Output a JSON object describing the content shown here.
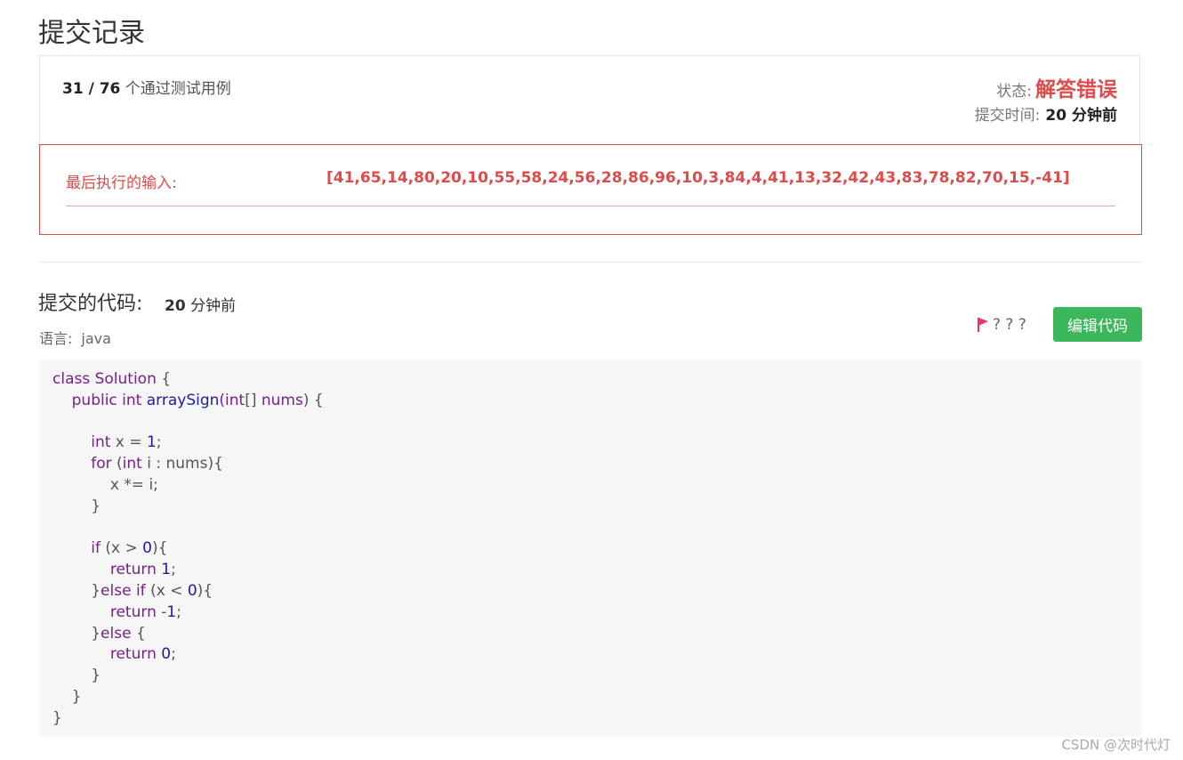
{
  "page_title": "提交记录",
  "result": {
    "passed": "31 / 76",
    "passed_suffix": "个通过测试用例",
    "status_label": "状态:",
    "status_value": "解答错误",
    "time_label": "提交时间:",
    "time_value": "20 分钟前"
  },
  "error": {
    "last_input_label": "最后执行的输入:",
    "last_input_value": "[41,65,14,80,20,10,55,58,24,56,28,86,96,10,3,84,4,41,13,32,42,43,83,78,82,70,15,-41]"
  },
  "code_section": {
    "title": "提交的代码:",
    "time_value": "20",
    "time_suffix": "分钟前",
    "lang_label": "语言:",
    "lang_value": "java",
    "flag_text": "? ? ?",
    "edit_button": "编辑代码"
  },
  "code_lines": [
    [
      [
        "kw",
        "class Solution"
      ],
      [
        "p",
        " {"
      ]
    ],
    [
      [
        "p",
        "    "
      ],
      [
        "kw",
        "public int "
      ],
      [
        "fn",
        "arraySign"
      ],
      [
        "kw",
        "(int"
      ],
      [
        "p",
        "[] "
      ],
      [
        "kw",
        "nums"
      ],
      [
        "p",
        ") {"
      ]
    ],
    [
      [
        "p",
        ""
      ]
    ],
    [
      [
        "p",
        "        "
      ],
      [
        "kw",
        "int"
      ],
      [
        "p",
        " x = "
      ],
      [
        "num",
        "1"
      ],
      [
        "p",
        ";"
      ]
    ],
    [
      [
        "p",
        "        "
      ],
      [
        "kw",
        "for"
      ],
      [
        "p",
        " ("
      ],
      [
        "kw",
        "int"
      ],
      [
        "p",
        " i : nums){"
      ]
    ],
    [
      [
        "p",
        "            x *= i;"
      ]
    ],
    [
      [
        "p",
        "        }"
      ]
    ],
    [
      [
        "p",
        ""
      ]
    ],
    [
      [
        "p",
        "        "
      ],
      [
        "kw",
        "if"
      ],
      [
        "p",
        " (x > "
      ],
      [
        "num",
        "0"
      ],
      [
        "p",
        "){"
      ]
    ],
    [
      [
        "p",
        "            "
      ],
      [
        "kw",
        "return"
      ],
      [
        "p",
        " "
      ],
      [
        "num",
        "1"
      ],
      [
        "p",
        ";"
      ]
    ],
    [
      [
        "p",
        "        }"
      ],
      [
        "kw",
        "else if"
      ],
      [
        "p",
        " (x < "
      ],
      [
        "num",
        "0"
      ],
      [
        "p",
        "){"
      ]
    ],
    [
      [
        "p",
        "            "
      ],
      [
        "kw",
        "return"
      ],
      [
        "p",
        " -"
      ],
      [
        "num",
        "1"
      ],
      [
        "p",
        ";"
      ]
    ],
    [
      [
        "p",
        "        }"
      ],
      [
        "kw",
        "else"
      ],
      [
        "p",
        " {"
      ]
    ],
    [
      [
        "p",
        "            "
      ],
      [
        "kw",
        "return"
      ],
      [
        "p",
        " "
      ],
      [
        "num",
        "0"
      ],
      [
        "p",
        ";"
      ]
    ],
    [
      [
        "p",
        "        }"
      ]
    ],
    [
      [
        "p",
        "    }"
      ]
    ],
    [
      [
        "p",
        "}"
      ]
    ]
  ],
  "watermark": "CSDN @次时代灯",
  "colors": {
    "error_red": "#e04a4a",
    "button_green": "#3cb75c",
    "flag_pink": "#f0325a",
    "code_bg": "#f6f6f6"
  },
  "icons": {
    "flag": "flag-icon"
  }
}
